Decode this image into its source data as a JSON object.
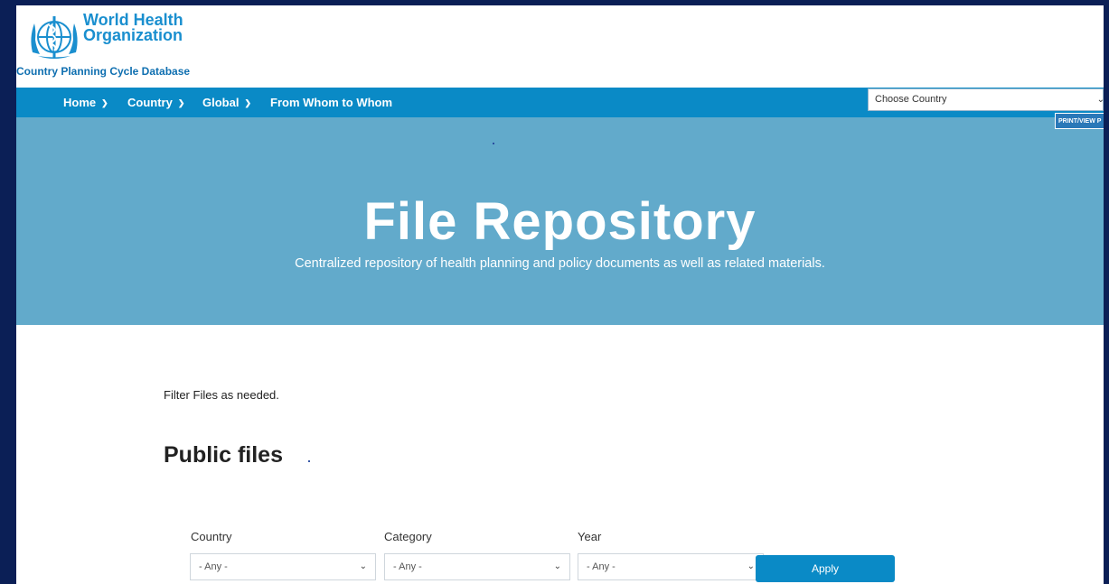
{
  "header": {
    "org_name": "World Health\nOrganization",
    "db_name": "Country Planning Cycle Database"
  },
  "nav": {
    "items": [
      {
        "label": "Home",
        "has_dropdown": true
      },
      {
        "label": "Country",
        "has_dropdown": true
      },
      {
        "label": "Global",
        "has_dropdown": true
      },
      {
        "label": "From Whom to Whom",
        "has_dropdown": false
      }
    ],
    "country_select": {
      "value": "Choose Country"
    },
    "print_label": "PRINT/VIEW P"
  },
  "hero": {
    "title": "File Repository",
    "subtitle": "Centralized repository of health planning and policy documents as well as related materials."
  },
  "content": {
    "filter_text": "Filter Files as needed.",
    "section_title": "Public files",
    "filters": [
      {
        "label": "Country",
        "value": "- Any -"
      },
      {
        "label": "Category",
        "value": "- Any -"
      },
      {
        "label": "Year",
        "value": "- Any -"
      }
    ],
    "apply_label": "Apply"
  },
  "colors": {
    "page_border": "#0b1f56",
    "nav_bg": "#0a8ac6",
    "hero_bg": "#62aacb",
    "brand": "#1a8fcf"
  }
}
